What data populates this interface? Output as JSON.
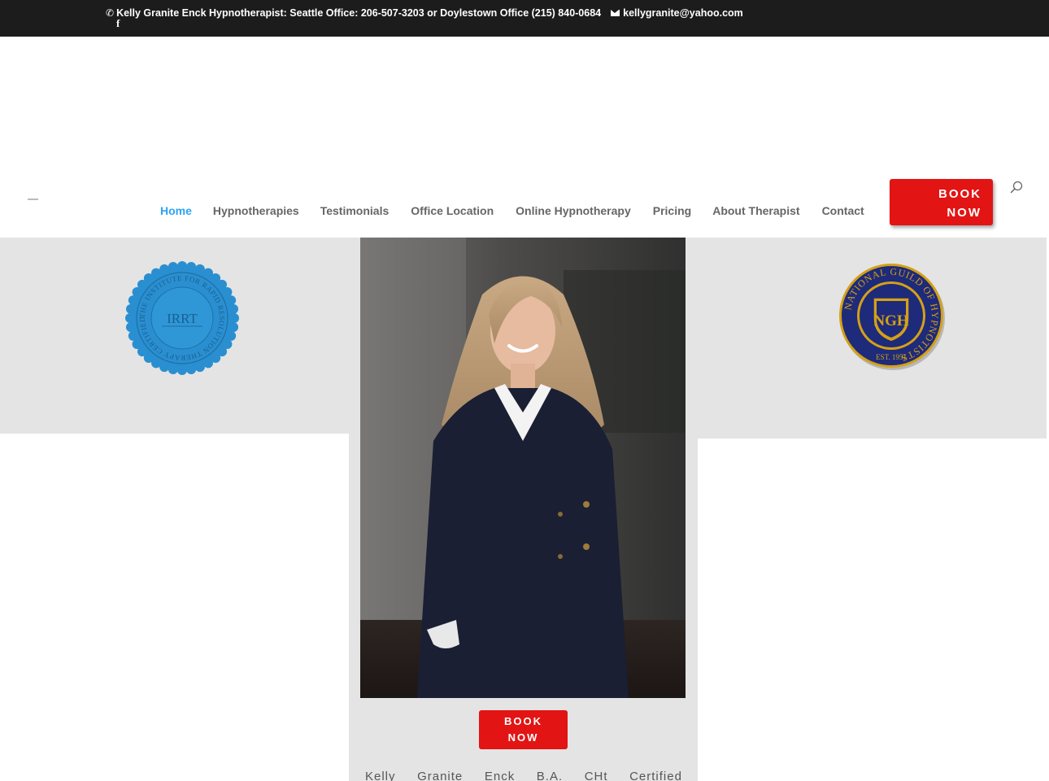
{
  "topbar": {
    "phone_icon": "phone-icon",
    "contact_text": "Kelly Granite Enck Hypnotherapist: Seattle Office: 206-507-3203 or Doylestown Office (215) 840-0684",
    "email": "kellygranite@yahoo.com",
    "facebook_glyph": "f"
  },
  "nav": {
    "items": [
      {
        "label": "Home",
        "active": true
      },
      {
        "label": "Hypnotherapies"
      },
      {
        "label": "Testimonials"
      },
      {
        "label": "Office Location"
      },
      {
        "label": "Online Hypnotherapy"
      },
      {
        "label": "Pricing"
      },
      {
        "label": "About Therapist"
      },
      {
        "label": "Contact"
      }
    ],
    "book_label_line1": "BOOK",
    "book_label_line2": "NOW"
  },
  "seals": {
    "irrt": {
      "center_text": "IRRT",
      "ring_text": "THE INSTITUTE FOR RAPID RESOLUTION THERAPY CERTIFIED PRACTITIONER PROGRAM"
    },
    "ngh": {
      "center_text": "NGH",
      "ring_text": "NATIONAL GUILD OF HYPNOTISTS",
      "est_text": "EST. 1951"
    }
  },
  "content": {
    "book_label_line1": "BOOK",
    "book_label_line2": "NOW",
    "bio_words": [
      "Kelly",
      "Granite",
      "Enck",
      "B.A.",
      "CHt",
      "Certified"
    ]
  },
  "colors": {
    "accent_blue": "#2ea3f2",
    "book_red": "#e21414",
    "topbar_bg": "#1c1c1c",
    "panel_gray": "#e4e4e4",
    "seal_blue": "#2a8fd0",
    "ngh_navy": "#1e2a7a",
    "ngh_gold": "#d4a017"
  }
}
